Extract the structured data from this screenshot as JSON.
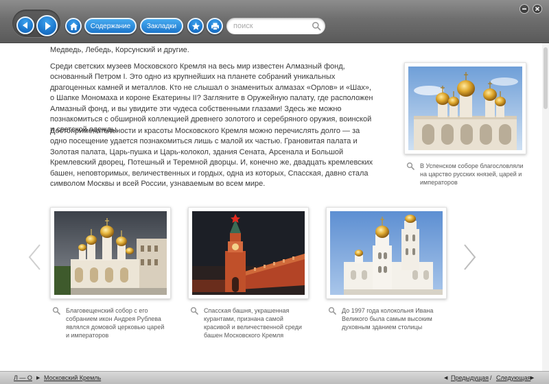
{
  "toolbar": {
    "contents_label": "Содержание",
    "bookmarks_label": "Закладки",
    "search_placeholder": "поиск"
  },
  "article": {
    "paragraphs": [
      "Медведь, Лебедь, Корсунский и другие.",
      "Среди светских музеев Московского Кремля на весь мир известен Алмазный фонд, основанный Петром I. Это одно из крупнейших на планете собраний уникальных драгоценных камней и металлов. Кто не слышал о знаменитых алмазах «Орлов» и «Шах», о Шапке Мономаха и короне Екатерины II? Загляните в Оружейную палату, где расположен Алмазный фонд, и вы увидите эти чудеса собственными глазами! Здесь же можно познакомиться с обширной коллекцией древнего золотого и серебряного оружия, воинской и светской одежды.",
      "Достопримечательности и красоты Московского Кремля можно перечислять долго — за одно посещение удается познакомиться лишь с малой их частью. Грановитая палата и Золотая палата, Царь-пушка и Царь-колокол, здания Сената, Арсенала и Большой Кремлевский дворец, Потешный и Теремной дворцы. И, конечно же, двадцать кремлевских башен, неповторимых, величественных и гордых, одна из которых, Спасская, давно стала символом Москвы и всей России, узнаваемым во всем мире."
    ]
  },
  "side_image": {
    "caption": "В Успенском соборе благословляли на царство русских князей, царей и императоров"
  },
  "gallery": [
    {
      "caption": "Благовещенский собор с его собранием икон Андрея Рублева являлся домовой церковью царей и императоров"
    },
    {
      "caption": "Спасская башня, украшенная курантами, признана самой красивой и величественной среди башен Московского Кремля"
    },
    {
      "caption": "До 1997 года колокольня Ивана Великого была самым высоким духовным зданием столицы"
    }
  ],
  "statusbar": {
    "breadcrumb_root": "Л — О",
    "breadcrumb_current": "Московский Кремль",
    "prev_label": "Предыдущая",
    "separator": "/",
    "next_label": "Следующая"
  },
  "colors": {
    "accent_blue": "#1c76cb",
    "toolbar_gray": "#6e6e6e"
  }
}
